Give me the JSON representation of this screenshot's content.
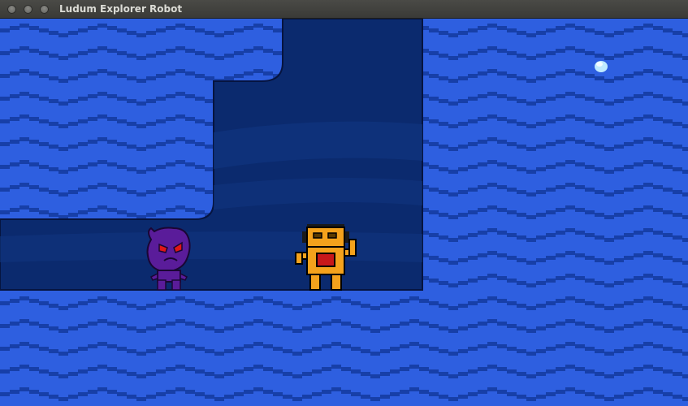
{
  "window": {
    "title": "Ludum Explorer Robot",
    "buttons": [
      "close",
      "minimize",
      "maximize"
    ]
  },
  "colors": {
    "water_light": "#2e5fe0",
    "water_dark": "#173fa8",
    "cave_dark": "#0b2a6e",
    "cave_band": "#10357f",
    "outline": "#061440",
    "robot_body": "#f4a21c",
    "robot_outline": "#000000",
    "robot_chest": "#c8181a",
    "enemy_body": "#5a1c9a",
    "enemy_eyes": "#e01616",
    "orb": "#bfeaff"
  },
  "entities": {
    "player": "robot-player",
    "enemy": "purple-alien-enemy",
    "pickup": "light-orb"
  }
}
